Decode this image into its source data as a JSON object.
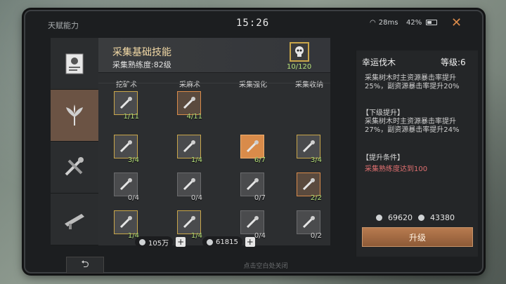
{
  "status": {
    "talent_title": "天赋能力",
    "time": "15:26",
    "network": "28ms",
    "battery": "42%"
  },
  "panel": {
    "title": "采集基础技能",
    "proficiency": "采集熟练度:82级",
    "boss_count": "10/120"
  },
  "columns": [
    "挖矿术",
    "采麻术",
    "采集强化",
    "采集收纳"
  ],
  "grid": [
    [
      {
        "count": "1/11",
        "style": "gold"
      },
      {
        "count": "4/11",
        "style": "orange"
      },
      null,
      null
    ],
    [
      {
        "count": "3/4",
        "style": "gold"
      },
      {
        "count": "1/4",
        "style": "gold"
      },
      {
        "count": "6/7",
        "style": "active"
      },
      {
        "count": "3/4",
        "style": "gold"
      }
    ],
    [
      {
        "count": "0/4",
        "style": "plain"
      },
      {
        "count": "0/4",
        "style": "plain"
      },
      {
        "count": "0/7",
        "style": "plain"
      },
      {
        "count": "2/2",
        "style": "orange"
      }
    ],
    [
      {
        "count": "1/4",
        "style": "gold"
      },
      {
        "count": "1/4",
        "style": "gold"
      },
      {
        "count": "0/4",
        "style": "plain"
      },
      {
        "count": "0/2",
        "style": "plain"
      }
    ]
  ],
  "resources": {
    "gold": "105万",
    "silver": "61815"
  },
  "detail": {
    "name": "幸运伐木",
    "level": "等级:6",
    "desc": "采集树木时主资源暴击率提升25%，副资源暴击率提升20%",
    "next_label": "【下级提升】",
    "next_desc": "采集树木时主资源暴击率提升27%，副资源暴击率提升24%",
    "req_label": "【提升条件】",
    "req_text": "采集熟练度达到100",
    "cost_gold": "69620",
    "cost_silver": "43380",
    "upgrade": "升级"
  },
  "footer": {
    "hint": "点击空白处关闭"
  },
  "colors": {
    "accent": "#d98b4a",
    "green": "#b7e27b",
    "red": "#e07070"
  }
}
